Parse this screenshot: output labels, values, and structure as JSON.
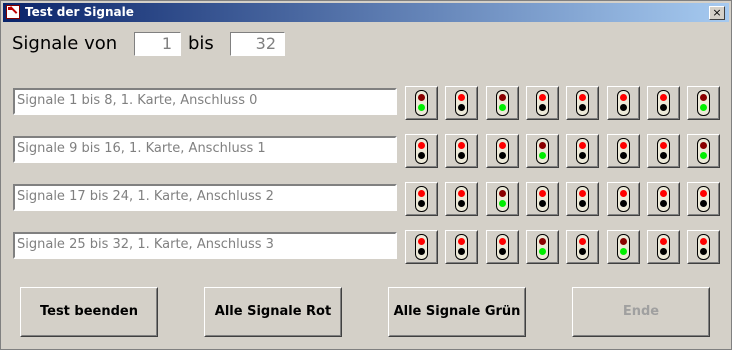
{
  "window": {
    "title": "Test der Signale",
    "close_label": "×"
  },
  "range": {
    "label_from": "Signale von",
    "from_value": "1",
    "label_to": "bis",
    "to_value": "32"
  },
  "rows": [
    {
      "label": "Signale 1 bis 8, 1. Karte, Anschluss 0",
      "signals": [
        "green",
        "red",
        "green",
        "red",
        "red",
        "red",
        "red",
        "green"
      ]
    },
    {
      "label": "Signale 9 bis 16, 1. Karte, Anschluss 1",
      "signals": [
        "red",
        "red",
        "red",
        "green",
        "red",
        "red",
        "red",
        "green"
      ]
    },
    {
      "label": "Signale 17 bis 24, 1. Karte, Anschluss 2",
      "signals": [
        "red",
        "red",
        "green",
        "red",
        "red",
        "red",
        "red",
        "red"
      ]
    },
    {
      "label": "Signale 25 bis 32, 1. Karte, Anschluss 3",
      "signals": [
        "red",
        "red",
        "red",
        "green",
        "red",
        "green",
        "red",
        "red"
      ]
    }
  ],
  "buttons": {
    "test_end": "Test beenden",
    "all_red": "Alle Signale Rot",
    "all_green": "Alle Signale Grün",
    "end": "Ende"
  },
  "colors": {
    "lamp_red": "#ff0000",
    "lamp_green": "#00ee00",
    "lamp_off": "#000000"
  }
}
